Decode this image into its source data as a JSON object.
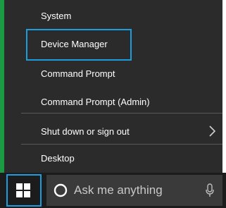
{
  "menu": {
    "items": [
      {
        "label": "System"
      },
      {
        "label": "Device Manager"
      },
      {
        "label": "Command Prompt"
      },
      {
        "label": "Command Prompt (Admin)"
      },
      {
        "label": "Shut down or sign out"
      },
      {
        "label": "Desktop"
      }
    ],
    "highlighted_item": "Device Manager"
  },
  "taskbar": {
    "search": {
      "placeholder": "Ask me anything"
    }
  },
  "colors": {
    "menu_bg": "#2b2b2b",
    "taskbar_bg": "#1c1c1c",
    "search_bg": "#3a3a3a",
    "highlight": "#1a9ee0",
    "accent_green": "#1c9a43"
  },
  "icons": [
    "windows-logo-icon",
    "cortana-circle-icon",
    "microphone-icon",
    "chevron-right-icon"
  ]
}
